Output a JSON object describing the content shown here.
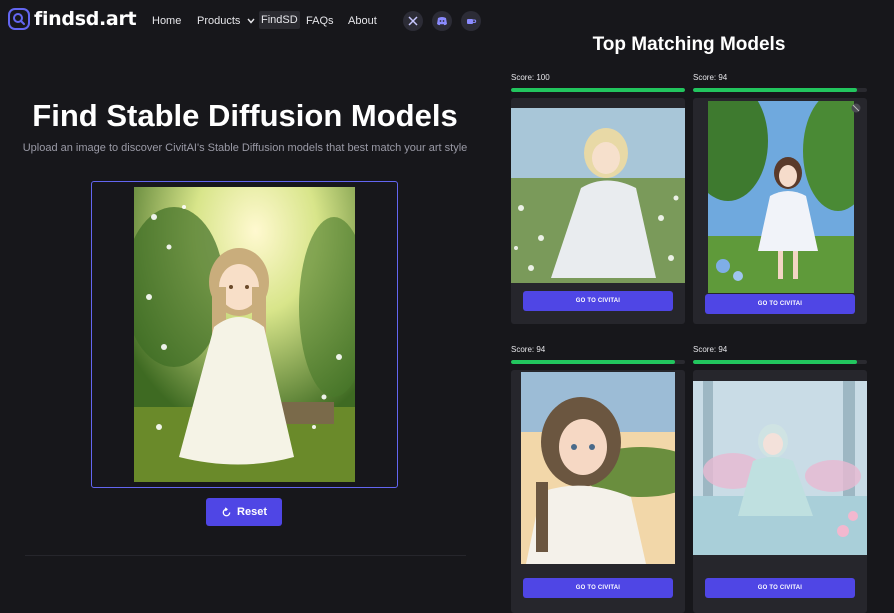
{
  "brand": {
    "name": "findsd.art"
  },
  "nav": {
    "home": "Home",
    "products": "Products",
    "findsd": "FindSD",
    "faqs": "FAQs",
    "about": "About"
  },
  "social": [
    "x-icon",
    "discord-icon",
    "coffee-icon"
  ],
  "hero": {
    "title": "Find Stable Diffusion Models",
    "subtitle": "Upload an image to discover CivitAI's Stable Diffusion models that best match your art style",
    "reset_label": "Reset"
  },
  "results": {
    "title": "Top Matching Models",
    "cards": [
      {
        "score_label": "Score: 100",
        "score": 100,
        "button": "GO TO CIVITAI"
      },
      {
        "score_label": "Score: 94",
        "score": 94,
        "button": "GO TO CIVITAI"
      },
      {
        "score_label": "Score: 94",
        "score": 94,
        "button": "GO TO CIVITAI"
      },
      {
        "score_label": "Score: 94",
        "score": 94,
        "button": "GO TO CIVITAI"
      }
    ]
  },
  "colors": {
    "accent": "#4f46e5",
    "score_bar": "#22c55e",
    "background": "#17171b"
  }
}
